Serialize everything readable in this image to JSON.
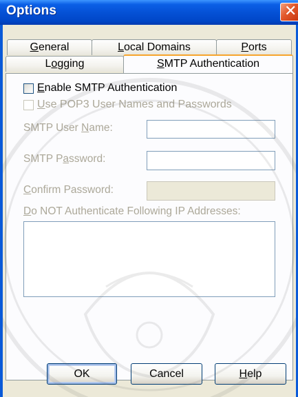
{
  "window": {
    "title": "Options",
    "close_glyph": "✕"
  },
  "tabs": {
    "row1": [
      {
        "label_pre": "",
        "label_u": "G",
        "label_post": "eneral"
      },
      {
        "label_pre": "",
        "label_u": "L",
        "label_post": "ocal Domains"
      },
      {
        "label_pre": "",
        "label_u": "P",
        "label_post": "orts"
      }
    ],
    "row2": [
      {
        "label_pre": "L",
        "label_u": "o",
        "label_post": "gging"
      },
      {
        "label_pre": "",
        "label_u": "S",
        "label_post": "MTP Authentication",
        "active": true
      }
    ]
  },
  "smtp": {
    "enable_pre": "",
    "enable_u": "E",
    "enable_post": "nable SMTP Authentication",
    "pop3_pre": "",
    "pop3_u": "U",
    "pop3_post": "se POP3 User Names and Passwords",
    "user_label_pre": "SMTP User ",
    "user_label_u": "N",
    "user_label_post": "ame:",
    "password_label_pre": "SMTP P",
    "password_label_u": "a",
    "password_label_post": "ssword:",
    "confirm_label_pre": "",
    "confirm_label_u": "C",
    "confirm_label_post": "onfirm Password:",
    "ip_label_pre": "",
    "ip_label_u": "D",
    "ip_label_post": "o NOT Authenticate Following IP Addresses:",
    "user_value": "",
    "password_value": "",
    "confirm_value": "",
    "ip_value": ""
  },
  "buttons": {
    "ok": "OK",
    "cancel": "Cancel",
    "help_u": "H",
    "help_post": "elp"
  },
  "colors": {
    "title_blue": "#0551d6",
    "close_red": "#e2582b",
    "tab_accent": "#f7a42c",
    "disabled_text": "#aca899"
  }
}
